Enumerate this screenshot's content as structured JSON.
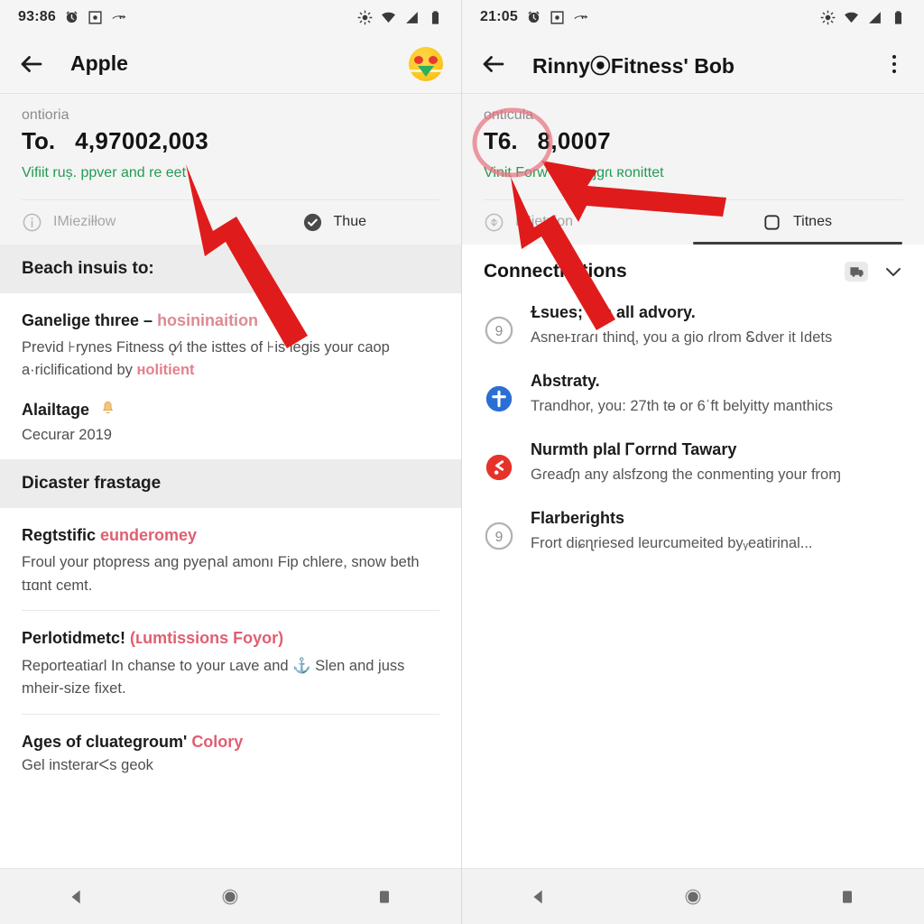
{
  "left": {
    "status": {
      "time": "93:86",
      "icons": [
        "alarm-icon",
        "screenshot-icon",
        "call-forward-icon",
        "brightness-icon",
        "wifi-icon",
        "signal-icon",
        "battery-icon"
      ]
    },
    "appbar": {
      "title": "Apple",
      "back": "back-arrow",
      "avatar": "emoji-avatar"
    },
    "summary": {
      "eyebrow": "ontioria",
      "label": "To.",
      "amount": "4,97002,003",
      "sub": "Vifiit ruș. ppver and re      eet"
    },
    "tabs": [
      {
        "label": "IMieziłłow",
        "icon": "info-circle-icon",
        "active": false
      },
      {
        "label": "Thue",
        "icon": "check-circle-filled-icon",
        "active": false
      }
    ],
    "sections": [
      {
        "header": "Beach insuis to:",
        "entries": [
          {
            "title": "Ganelige thıree – ",
            "title_accent": "hosininaition",
            "body": "Previd ⊦rynes Fitness ǫ⁄i the isttes of ⊦is legis your caop a·riclificationd by ",
            "body_accent": "ʜolitient"
          },
          {
            "title": "Alailtage",
            "title_accent": "",
            "bell": true,
            "sub": "Cecurar 2019"
          }
        ]
      },
      {
        "header": "Dicaster frastage",
        "entries": [
          {
            "title": "Regtstific ",
            "title_accent": "eunderomey",
            "body": "Froul your ptopress ang pyeրal amonı Fip chlere, snow beth tɪɑnt cemt."
          },
          {
            "title": "Perlotidmetc! ",
            "title_accent": "(ʟumtissions Foyor)",
            "body": "Reporteatiaɾl In chanse to your ʟave and ⚓ Slen and juss mheir-size fixet."
          },
          {
            "title": "Ages of cluategroum' ",
            "title_accent": "Colory",
            "sub": "Gel insterarᐸs geok"
          }
        ]
      }
    ],
    "nav": [
      "back-nav-button",
      "home-nav-button",
      "recents-nav-button"
    ]
  },
  "right": {
    "status": {
      "time": "21:05"
    },
    "appbar": {
      "title": "Rinny⦿Fitness' Bob",
      "back": "back-arrow",
      "menu": "overflow-menu"
    },
    "summary": {
      "eyebrow": "onticula",
      "label": "T6.",
      "amount": "8,0007",
      "sub": "Vinit Forw  ɡɾea  ɱɡɾɩ  ʀonittet"
    },
    "tabs": [
      {
        "label": "IMietᴋion",
        "icon": "info-circle-icon",
        "active": false
      },
      {
        "label": "Titnes",
        "icon": "square-outline-icon",
        "active": true
      }
    ],
    "list": {
      "header": "Connectitations",
      "actions": [
        "receipt-badge-icon",
        "chevron-down-icon"
      ],
      "items": [
        {
          "icon": "gray-circle-9-icon",
          "title": "Ɫsues; the all advory.",
          "body": "Asneⱶɪɾaɾı thinɖ, you a gio ɾlrom Ꮛdver it Idets"
        },
        {
          "icon": "blue-plus-circle-icon",
          "title": "Abstraty.",
          "body": "Trandhor, you: 27th tɵ or 6ˈft belyitty manthics"
        },
        {
          "icon": "red-share-circle-icon",
          "title": "Nurmth plal Ꮁorrnd Tawary",
          "body": "Gɾeaɗɲ any alsfzong the conmenting your froɱ"
        },
        {
          "icon": "gray-circle-9-icon",
          "title": "Flarberights",
          "body": "Frort diɕɳriesed leurcumeited byᵧeatirinal..."
        }
      ]
    },
    "nav": [
      "back-nav-button",
      "home-nav-button",
      "recents-nav-button"
    ]
  },
  "annotations": {
    "arrow_color": "#e01b1b",
    "ellipse_color": "#e8737f",
    "arrows": [
      {
        "name": "left-arrow-to-amount"
      },
      {
        "name": "right-arrow-to-amount"
      },
      {
        "name": "right-arrow-to-subtext"
      }
    ],
    "ellipse": {
      "name": "highlight-ellipse-label"
    }
  }
}
